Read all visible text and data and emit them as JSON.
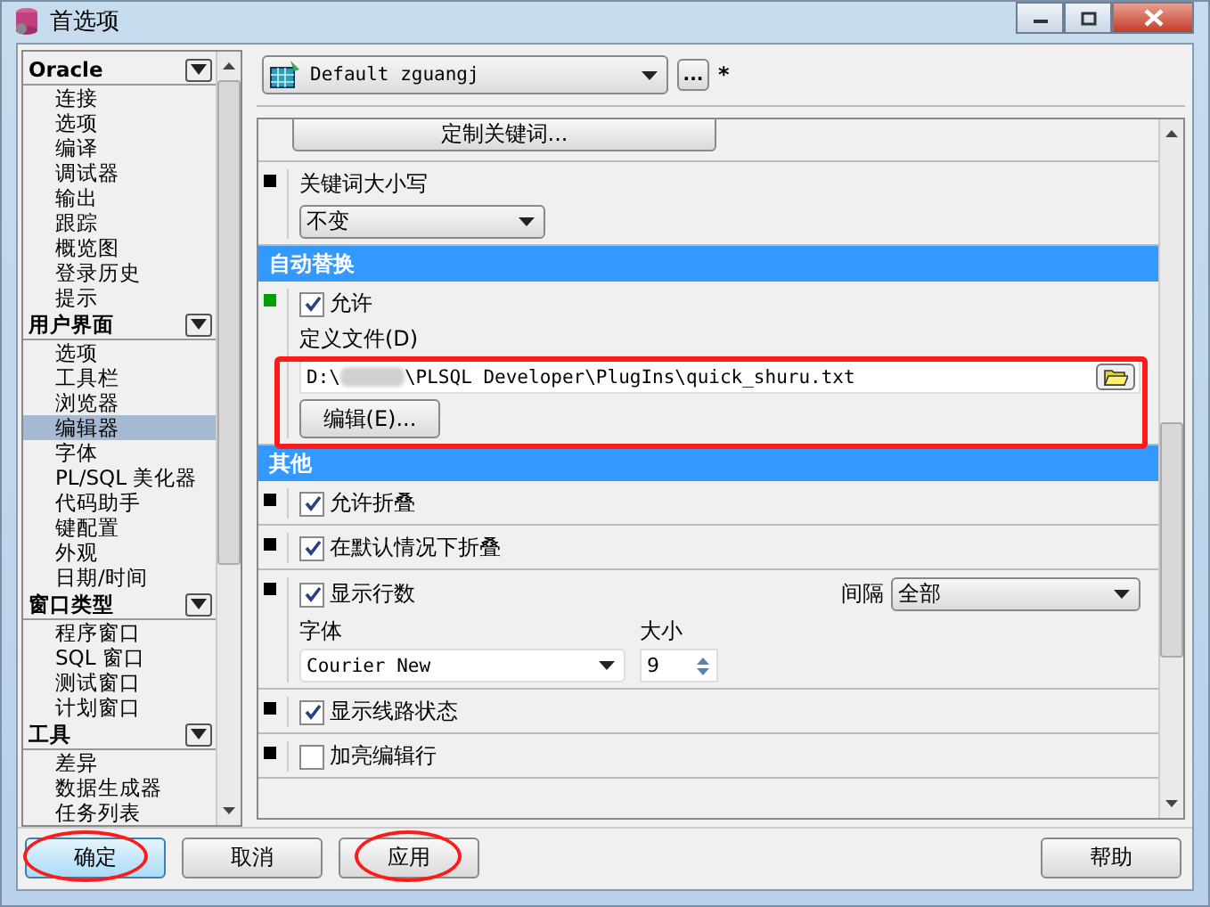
{
  "window": {
    "title": "首选项"
  },
  "sidebar": {
    "groups": [
      {
        "title": "Oracle",
        "expanded": true,
        "items": [
          {
            "label": "连接",
            "selected": false
          },
          {
            "label": "选项",
            "selected": false
          },
          {
            "label": "编译",
            "selected": false
          },
          {
            "label": "调试器",
            "selected": false
          },
          {
            "label": "输出",
            "selected": false
          },
          {
            "label": "跟踪",
            "selected": false
          },
          {
            "label": "概览图",
            "selected": false
          },
          {
            "label": "登录历史",
            "selected": false
          },
          {
            "label": "提示",
            "selected": false
          }
        ]
      },
      {
        "title": "用户界面",
        "expanded": true,
        "items": [
          {
            "label": "选项",
            "selected": false
          },
          {
            "label": "工具栏",
            "selected": false
          },
          {
            "label": "浏览器",
            "selected": false
          },
          {
            "label": "编辑器",
            "selected": true
          },
          {
            "label": "字体",
            "selected": false
          },
          {
            "label": "PL/SQL 美化器",
            "selected": false
          },
          {
            "label": "代码助手",
            "selected": false
          },
          {
            "label": "键配置",
            "selected": false
          },
          {
            "label": "外观",
            "selected": false
          },
          {
            "label": "日期/时间",
            "selected": false
          }
        ]
      },
      {
        "title": "窗口类型",
        "expanded": true,
        "items": [
          {
            "label": "程序窗口",
            "selected": false
          },
          {
            "label": "SQL 窗口",
            "selected": false
          },
          {
            "label": "测试窗口",
            "selected": false
          },
          {
            "label": "计划窗口",
            "selected": false
          }
        ]
      },
      {
        "title": "工具",
        "expanded": true,
        "items": [
          {
            "label": "差异",
            "selected": false
          },
          {
            "label": "数据生成器",
            "selected": false
          },
          {
            "label": "任务列表",
            "selected": false
          }
        ]
      }
    ]
  },
  "profile": {
    "value": "Default zguangj",
    "more_button": "...",
    "modified_mark": "*"
  },
  "settings": [
    {
      "kind": "button",
      "label": "定制关键词..."
    },
    {
      "kind": "select",
      "color": "#000000",
      "label": "关键词大小写",
      "value": "不变"
    },
    {
      "kind": "header",
      "title": "自动替换"
    },
    {
      "kind": "file",
      "color": "#00a000",
      "label": "允许",
      "checked": true,
      "file_label": "定义文件(D)",
      "path_start": "D:\\",
      "path_end": "\\PLSQL Developer\\PlugIns\\quick_shuru.txt",
      "edit_button": "编辑(E)..."
    },
    {
      "kind": "header",
      "title": "其他"
    },
    {
      "kind": "checkbox",
      "color": "#000000",
      "label": "允许折叠",
      "checked": true
    },
    {
      "kind": "checkbox",
      "color": "#000000",
      "label": "在默认情况下折叠",
      "checked": true
    },
    {
      "kind": "linenumbers",
      "color": "#000000",
      "label": "显示行数",
      "checked": true,
      "interval_label": "间隔",
      "interval_value": "全部",
      "font_label": "字体",
      "font_value": "Courier New",
      "size_label": "大小",
      "size_value": "9"
    },
    {
      "kind": "checkbox",
      "color": "#000000",
      "label": "显示线路状态",
      "checked": true
    },
    {
      "kind": "checkbox",
      "color": "#000000",
      "label": "加亮编辑行",
      "checked": false
    }
  ],
  "buttons": [
    {
      "label": "确定",
      "default": true
    },
    {
      "label": "取消",
      "default": false
    },
    {
      "label": "应用",
      "default": false
    }
  ],
  "help_button": "帮助"
}
